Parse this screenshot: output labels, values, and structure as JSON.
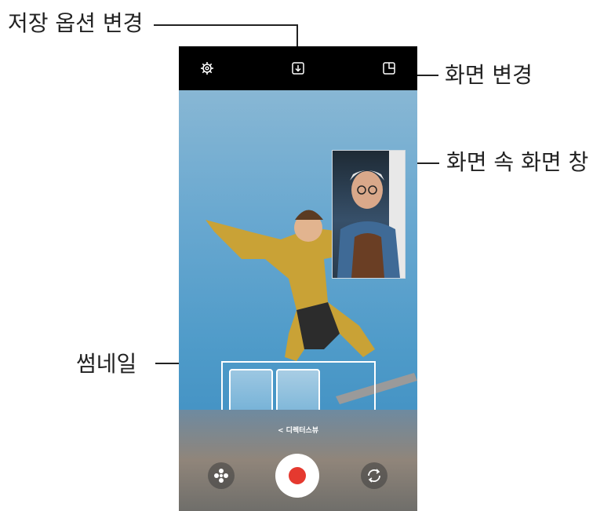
{
  "callouts": {
    "save_options": "저장 옵션 변경",
    "change_screen": "화면 변경",
    "pip_window": "화면 속 화면 창",
    "thumbnail": "썸네일"
  },
  "camera": {
    "director_view_link": "< 디렉터스뷰",
    "icons": [
      "gear-icon",
      "save-download-icon",
      "screen-layout-icon",
      "effects-icon",
      "record-icon",
      "switch-camera-icon"
    ]
  },
  "colors": {
    "record": "#e5392f",
    "topbar": "#000000",
    "sky": "#5a9fc9"
  }
}
